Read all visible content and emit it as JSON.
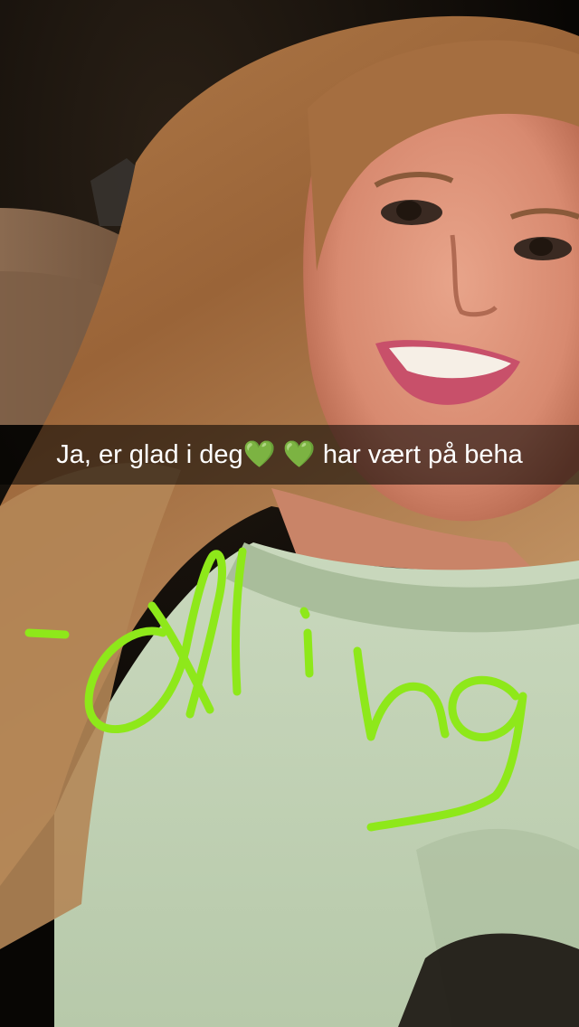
{
  "caption": {
    "text_before": "Ja, er glad i deg",
    "hearts": "💚 💚",
    "text_after": " har vært på beha"
  },
  "doodle": {
    "text": "-Øling",
    "color": "#8ee81a"
  },
  "colors": {
    "caption_bar": "rgba(0,0,0,0.55)",
    "caption_text": "#ffffff",
    "doodle_stroke": "#8ee81a"
  }
}
